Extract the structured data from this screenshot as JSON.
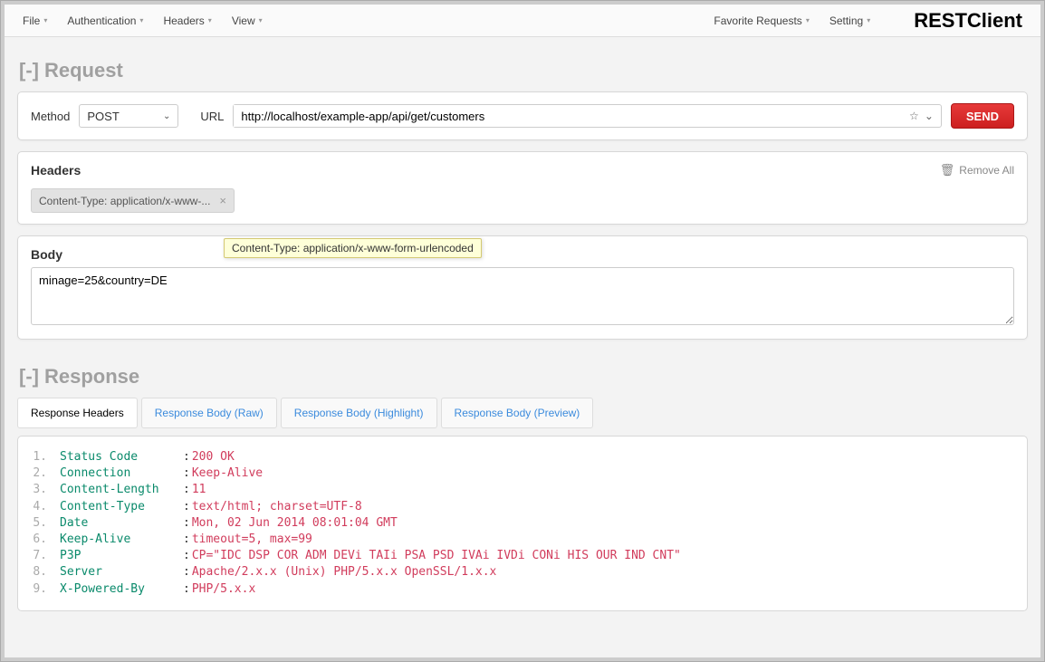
{
  "menubar": {
    "left": [
      "File",
      "Authentication",
      "Headers",
      "View"
    ],
    "right": [
      "Favorite Requests",
      "Setting"
    ],
    "brand": "RESTClient"
  },
  "request": {
    "section_label": "Request",
    "collapse": "[-]",
    "method_label": "Method",
    "method_value": "POST",
    "url_label": "URL",
    "url_value": "http://localhost/example-app/api/get/customers",
    "send_label": "SEND"
  },
  "headers": {
    "title": "Headers",
    "remove_all": "Remove All",
    "chip_text": "Content-Type: application/x-www-...",
    "tooltip": "Content-Type: application/x-www-form-urlencoded"
  },
  "body": {
    "title": "Body",
    "value": "minage=25&country=DE"
  },
  "response": {
    "section_label": "Response",
    "collapse": "[-]",
    "tabs": [
      "Response Headers",
      "Response Body (Raw)",
      "Response Body (Highlight)",
      "Response Body (Preview)"
    ],
    "active_tab": 0,
    "headers": [
      {
        "n": "1.",
        "key": "Status Code",
        "val": "200 OK"
      },
      {
        "n": "2.",
        "key": "Connection",
        "val": "Keep-Alive"
      },
      {
        "n": "3.",
        "key": "Content-Length",
        "val": "11"
      },
      {
        "n": "4.",
        "key": "Content-Type",
        "val": "text/html; charset=UTF-8"
      },
      {
        "n": "5.",
        "key": "Date",
        "val": "Mon, 02 Jun 2014 08:01:04 GMT"
      },
      {
        "n": "6.",
        "key": "Keep-Alive",
        "val": "timeout=5, max=99"
      },
      {
        "n": "7.",
        "key": "P3P",
        "val": "CP=\"IDC DSP COR ADM DEVi TAIi PSA PSD IVAi IVDi CONi HIS OUR IND CNT\""
      },
      {
        "n": "8.",
        "key": "Server",
        "val": "Apache/2.x.x (Unix) PHP/5.x.x OpenSSL/1.x.x"
      },
      {
        "n": "9.",
        "key": "X-Powered-By",
        "val": "PHP/5.x.x"
      }
    ]
  }
}
